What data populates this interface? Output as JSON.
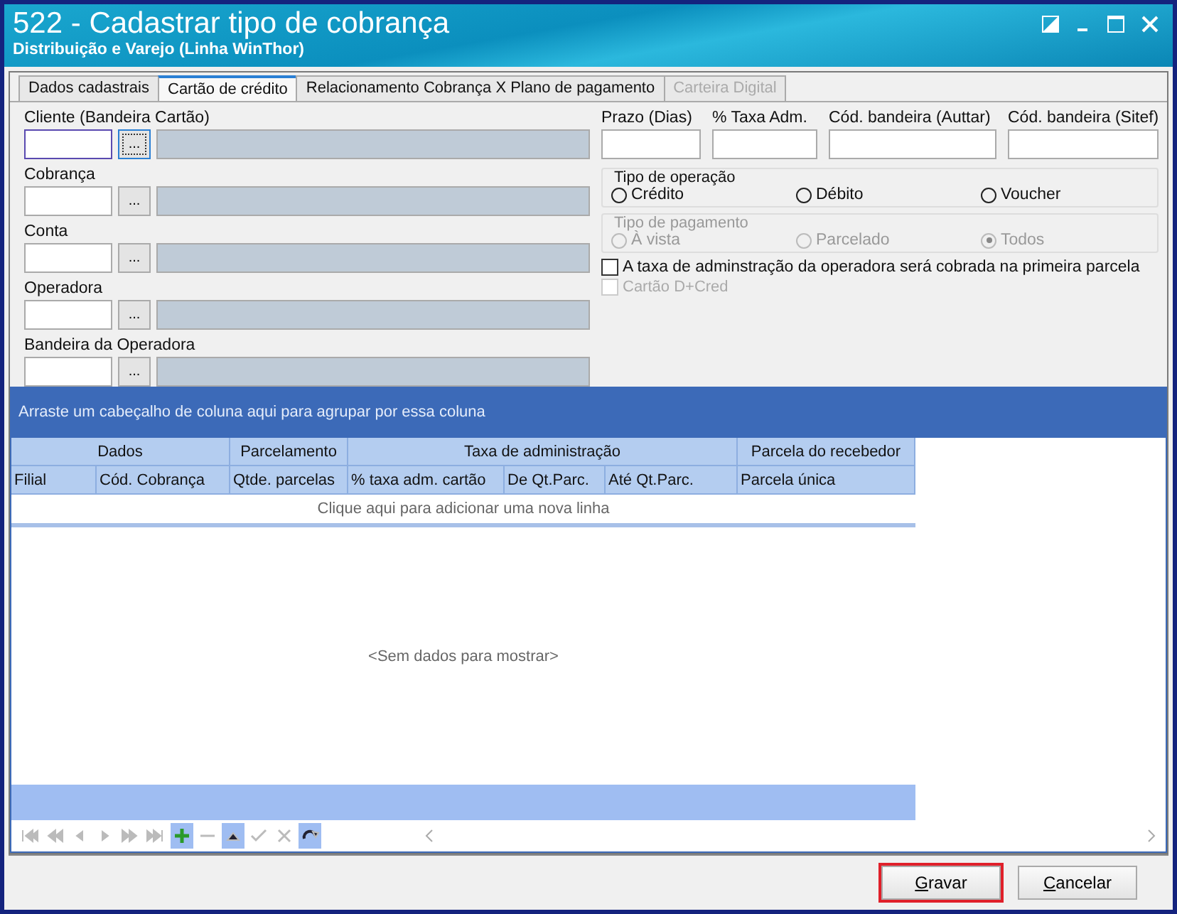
{
  "window": {
    "title": "522 - Cadastrar tipo de cobrança",
    "subtitle": "Distribuição e Varejo (Linha WinThor)"
  },
  "tabs": [
    {
      "label": "Dados cadastrais",
      "selected": false,
      "disabled": false
    },
    {
      "label": "Cartão de crédito",
      "selected": true,
      "disabled": false
    },
    {
      "label": "Relacionamento Cobrança X Plano de pagamento",
      "selected": false,
      "disabled": false
    },
    {
      "label": "Carteira Digital",
      "selected": false,
      "disabled": true
    }
  ],
  "lookups": [
    {
      "label": "Cliente (Bandeira Cartão)",
      "focused": true
    },
    {
      "label": "Cobrança",
      "focused": false
    },
    {
      "label": "Conta",
      "focused": false
    },
    {
      "label": "Operadora",
      "focused": false
    },
    {
      "label": "Bandeira da Operadora",
      "focused": false
    }
  ],
  "lookup_button": "...",
  "fields": [
    {
      "label": "Prazo (Dias)"
    },
    {
      "label": "% Taxa Adm."
    },
    {
      "label": "Cód. bandeira (Auttar)"
    },
    {
      "label": "Cód. bandeira (Sitef)"
    }
  ],
  "radio_groups": [
    {
      "title": "Tipo de operação",
      "disabled": false,
      "options": [
        {
          "label": "Crédito",
          "selected": false
        },
        {
          "label": "Débito",
          "selected": false
        },
        {
          "label": "Voucher",
          "selected": false
        }
      ]
    },
    {
      "title": "Tipo de pagamento",
      "disabled": true,
      "options": [
        {
          "label": "À vista",
          "selected": false
        },
        {
          "label": "Parcelado",
          "selected": false
        },
        {
          "label": "Todos",
          "selected": true
        }
      ]
    }
  ],
  "checkboxes": [
    {
      "label": "A taxa de adminstração da operadora será cobrada na primeira parcela",
      "checked": false,
      "disabled": false
    },
    {
      "label": "Cartão D+Cred",
      "checked": false,
      "disabled": true
    }
  ],
  "grid": {
    "group_panel": "Arraste um cabeçalho de coluna aqui para agrupar por essa coluna",
    "bands": [
      "Dados",
      "Parcelamento",
      "Taxa de administração",
      "Parcela do recebedor"
    ],
    "columns": [
      "Filial",
      "Cód. Cobrança",
      "Qtde. parcelas",
      "% taxa adm. cartão",
      "De Qt.Parc.",
      "Até Qt.Parc.",
      "Parcela única"
    ],
    "new_row": "Clique aqui para adicionar uma nova linha",
    "empty": "<Sem dados para mostrar>",
    "navigator": [
      {
        "kind": "first",
        "active": false
      },
      {
        "kind": "prev-page",
        "active": false
      },
      {
        "kind": "prev",
        "active": false
      },
      {
        "kind": "next",
        "active": false
      },
      {
        "kind": "next-page",
        "active": false
      },
      {
        "kind": "last",
        "active": false
      },
      {
        "kind": "add",
        "active": true
      },
      {
        "kind": "remove",
        "active": false
      },
      {
        "kind": "up",
        "active": true
      },
      {
        "kind": "check",
        "active": false
      },
      {
        "kind": "cancel",
        "active": false
      },
      {
        "kind": "refresh",
        "active": true
      }
    ]
  },
  "buttons": [
    {
      "label": "Gravar",
      "highlighted": true
    },
    {
      "label": "Cancelar",
      "highlighted": false
    }
  ]
}
